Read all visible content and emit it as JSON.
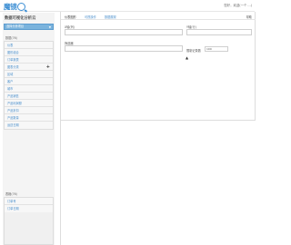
{
  "header": {
    "logo_text": "魔镜",
    "user_menu": "您好，欢迎(一个 ...)"
  },
  "sidebar": {
    "system_title": "数据可视化分析云",
    "project_select": "选择分析项目",
    "group1_title": "数据(76)",
    "group1_items": [
      {
        "label": "仪表"
      },
      {
        "label": "图形组合"
      },
      {
        "label": "订单报表"
      },
      {
        "label": "图表分类"
      },
      {
        "label": "区域"
      },
      {
        "label": "客户"
      },
      {
        "label": "城市"
      },
      {
        "label": "产品销售"
      },
      {
        "label": "产品利润额"
      },
      {
        "label": "产品折扣"
      },
      {
        "label": "产品数量"
      },
      {
        "label": "运送日期"
      }
    ],
    "group1_plus": "+",
    "group2_title": "表格(76)",
    "group2_items": [
      {
        "label": "订单号"
      },
      {
        "label": "订单日期"
      }
    ]
  },
  "main": {
    "tabs": [
      {
        "label": "仪表图形"
      },
      {
        "label": "可视操作"
      },
      {
        "label": "数据展现"
      }
    ],
    "help_label": "帮助",
    "field_labels": {
      "x_axis": "X轴(列)",
      "y_axis": "Y轴(行)",
      "filter": "筛选器",
      "row_count": "限制记录数"
    },
    "row_count_value": "100",
    "caret_glyph": "▲"
  }
}
